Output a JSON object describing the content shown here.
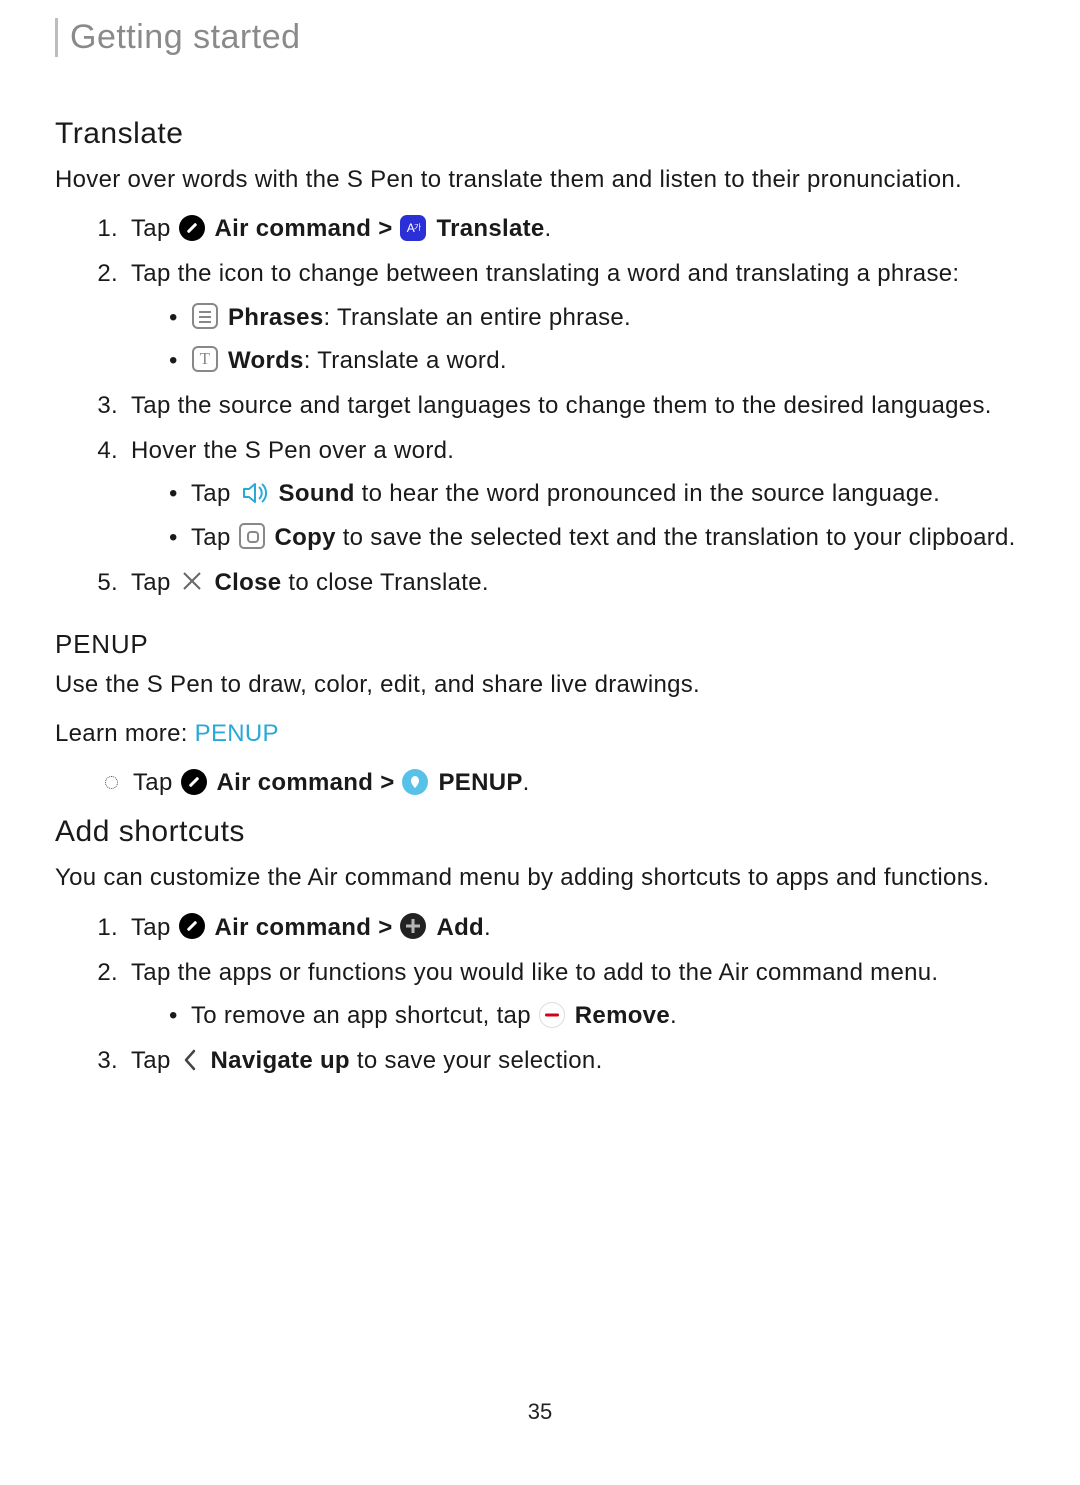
{
  "breadcrumb": "Getting started",
  "translate": {
    "heading": "Translate",
    "intro": "Hover over words with the S Pen to translate them and listen to their pronunciation.",
    "step1_tap": "Tap",
    "air_command_label": "Air command",
    "gt": ">",
    "translate_label": "Translate",
    "period": ".",
    "step2": "Tap the icon to change between translating a word and translating a phrase:",
    "phrases_label": "Phrases",
    "phrases_desc": ": Translate an entire phrase.",
    "words_label": "Words",
    "words_desc": ": Translate a word.",
    "step3": "Tap the source and target languages to change them to the desired languages.",
    "step4": "Hover the S Pen over a word.",
    "sound_tap": "Tap",
    "sound_label": "Sound",
    "sound_desc": " to hear the word pronounced in the source language.",
    "copy_tap": "Tap",
    "copy_label": "Copy",
    "copy_desc": " to save the selected text and the translation to your clipboard.",
    "step5_tap": "Tap",
    "close_label": "Close",
    "step5_desc": " to close Translate."
  },
  "penup": {
    "heading": "PENUP",
    "intro": "Use the S Pen to draw, color, edit, and share live drawings.",
    "learn_more_prefix": "Learn more: ",
    "learn_more_link": "PENUP",
    "step_tap": "Tap",
    "air_command_label": "Air command",
    "gt": ">",
    "penup_label": "PENUP",
    "period": "."
  },
  "shortcuts": {
    "heading": "Add shortcuts",
    "intro": "You can customize the Air command menu by adding shortcuts to apps and functions.",
    "step1_tap": "Tap",
    "air_command_label": "Air command",
    "gt": ">",
    "add_label": "Add",
    "period": ".",
    "step2": "Tap the apps or functions you would like to add to the Air command menu.",
    "remove_prefix": "To remove an app shortcut, tap",
    "remove_label": "Remove",
    "step3_tap": "Tap",
    "navup_label": "Navigate up",
    "step3_desc": " to save your selection."
  },
  "page_number": "35"
}
